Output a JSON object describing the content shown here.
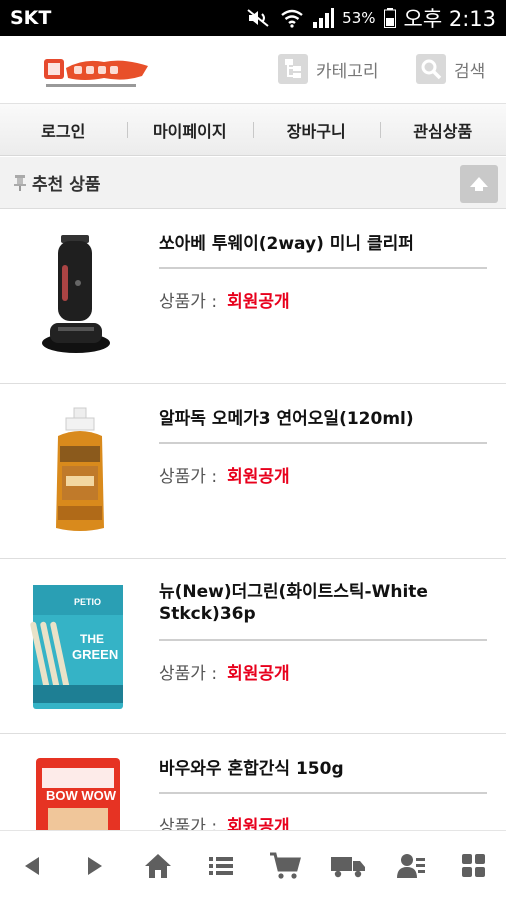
{
  "status_bar": {
    "carrier": "SKT",
    "battery": "53%",
    "time": "오후 2:13"
  },
  "header": {
    "category_label": "카테고리",
    "search_label": "검색"
  },
  "nav": {
    "items": [
      "로그인",
      "마이페이지",
      "장바구니",
      "관심상품"
    ]
  },
  "section": {
    "title": "추천 상품"
  },
  "products": [
    {
      "name": "쏘아베 투웨이(2way) 미니 클리퍼",
      "price_label": "상품가 :",
      "price_value": "회원공개"
    },
    {
      "name": "알파독 오메가3 연어오일(120ml)",
      "price_label": "상품가 :",
      "price_value": "회원공개"
    },
    {
      "name": "뉴(New)더그린(화이트스틱-White Stkck)36p",
      "price_label": "상품가 :",
      "price_value": "회원공개"
    },
    {
      "name": "바우와우 혼합간식 150g",
      "price_label": "상품가 :",
      "price_value": "회원공개"
    }
  ],
  "product_images": {
    "p3_brand": "PETIO",
    "p3_title1": "THE",
    "p3_title2": "GREEN",
    "p4_brand": "BOW WOW"
  },
  "icons": {
    "header": [
      "category-icon",
      "search-icon"
    ],
    "bottom": [
      "back-icon",
      "forward-icon",
      "home-icon",
      "list-icon",
      "cart-icon",
      "delivery-truck-icon",
      "my-account-icon",
      "grid-menu-icon"
    ]
  },
  "colors": {
    "price_red": "#e8001c",
    "icon_gray": "#5f5f5f",
    "statusbar_bg": "#000000"
  }
}
